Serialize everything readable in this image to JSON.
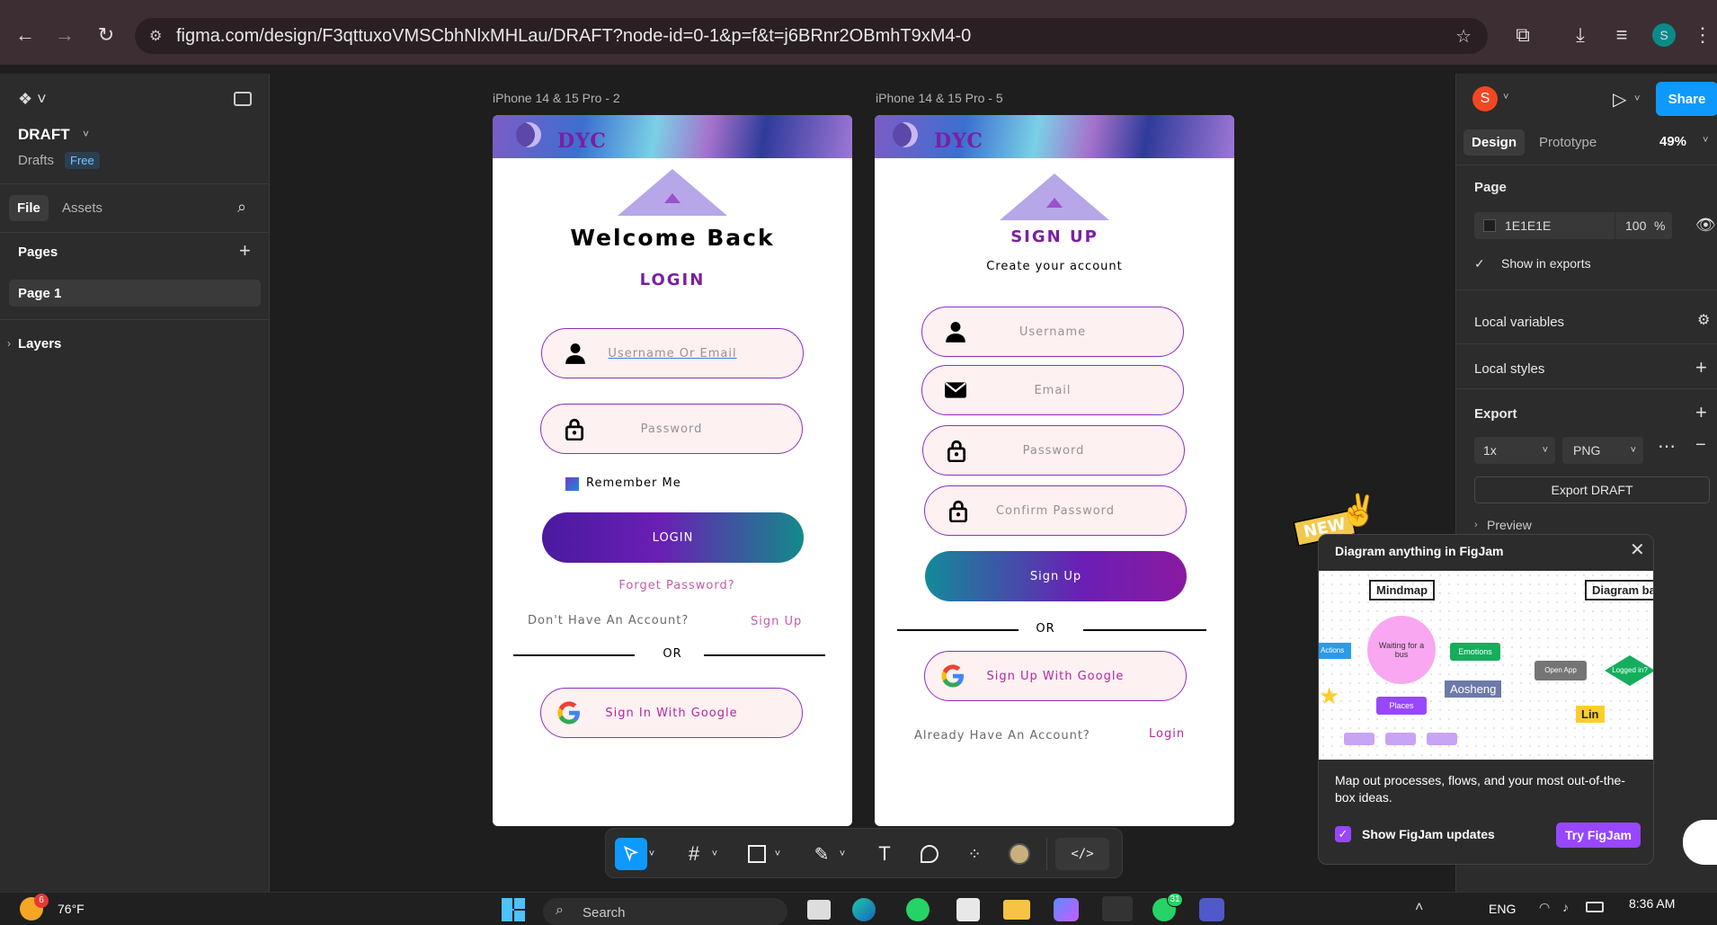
{
  "browser": {
    "url": "figma.com/design/F3qttuxoVMSCbhNlxMHLau/DRAFT?node-id=0-1&p=f&t=j6BRnr2OBmhT9xM4-0",
    "profile_initial": "S"
  },
  "left_panel": {
    "file_name": "DRAFT",
    "drafts_label": "Drafts",
    "plan_badge": "Free",
    "tabs": [
      "File",
      "Assets"
    ],
    "pages_label": "Pages",
    "page_item": "Page 1",
    "layers_label": "Layers"
  },
  "canvas": {
    "frame1_label": "iPhone 14 & 15 Pro - 2",
    "frame2_label": "iPhone 14 & 15 Pro - 5",
    "brand": "DYC",
    "login": {
      "title": "Welcome Back",
      "subtitle": "LOGIN",
      "username_placeholder": "Username Or Email",
      "password_placeholder": "Password",
      "remember_label": "Remember Me",
      "login_button": "LOGIN",
      "forgot": "Forget Password?",
      "no_account": "Don't Have An Account?",
      "signup_link": "Sign Up",
      "or": "OR",
      "google_button": "Sign In With Google"
    },
    "signup": {
      "title": "SIGN UP",
      "subtitle": "Create your account",
      "username_placeholder": "Username",
      "email_placeholder": "Email",
      "password_placeholder": "Password",
      "confirm_placeholder": "Confirm Password",
      "signup_button": "Sign Up",
      "or": "OR",
      "google_button": "Sign Up With Google",
      "have_account": "Already Have An Account?",
      "login_link": "Login"
    }
  },
  "right_panel": {
    "avatar_initial": "S",
    "share_button": "Share",
    "tabs": [
      "Design",
      "Prototype"
    ],
    "zoom": "49%",
    "page_label": "Page",
    "page_color": "1E1E1E",
    "page_opacity": "100",
    "percent": "%",
    "show_in_exports": "Show in exports",
    "local_variables": "Local variables",
    "local_styles": "Local styles",
    "export_label": "Export",
    "export_scale": "1x",
    "export_format": "PNG",
    "export_button": "Export DRAFT",
    "preview_label": "Preview"
  },
  "figjam_popup": {
    "new_badge": "NEW",
    "title": "Diagram anything in FigJam",
    "mindmap_label": "Mindmap",
    "diagram_label": "Diagram ba",
    "node_center": "Waiting for a bus",
    "node_actions": "Actions",
    "node_emotions": "Emotions",
    "node_places": "Places",
    "cursor_name": "Aosheng",
    "node_open_app": "Open App",
    "node_logged_in": "Logged in?",
    "cursor_name2": "Lin",
    "description": "Map out processes, flows, and your most out-of-the-box ideas.",
    "checkbox_label": "Show FigJam updates",
    "try_button": "Try FigJam"
  },
  "taskbar": {
    "weather": "76°F",
    "weather_badge": "6",
    "search_placeholder": "Search",
    "lang": "ENG",
    "time": "8:36 AM",
    "whatsapp_badge": "31"
  },
  "colors": {
    "figma_blue": "#0d99ff",
    "brand_purple": "#7b1fa2",
    "figjam_purple": "#9747ff"
  }
}
